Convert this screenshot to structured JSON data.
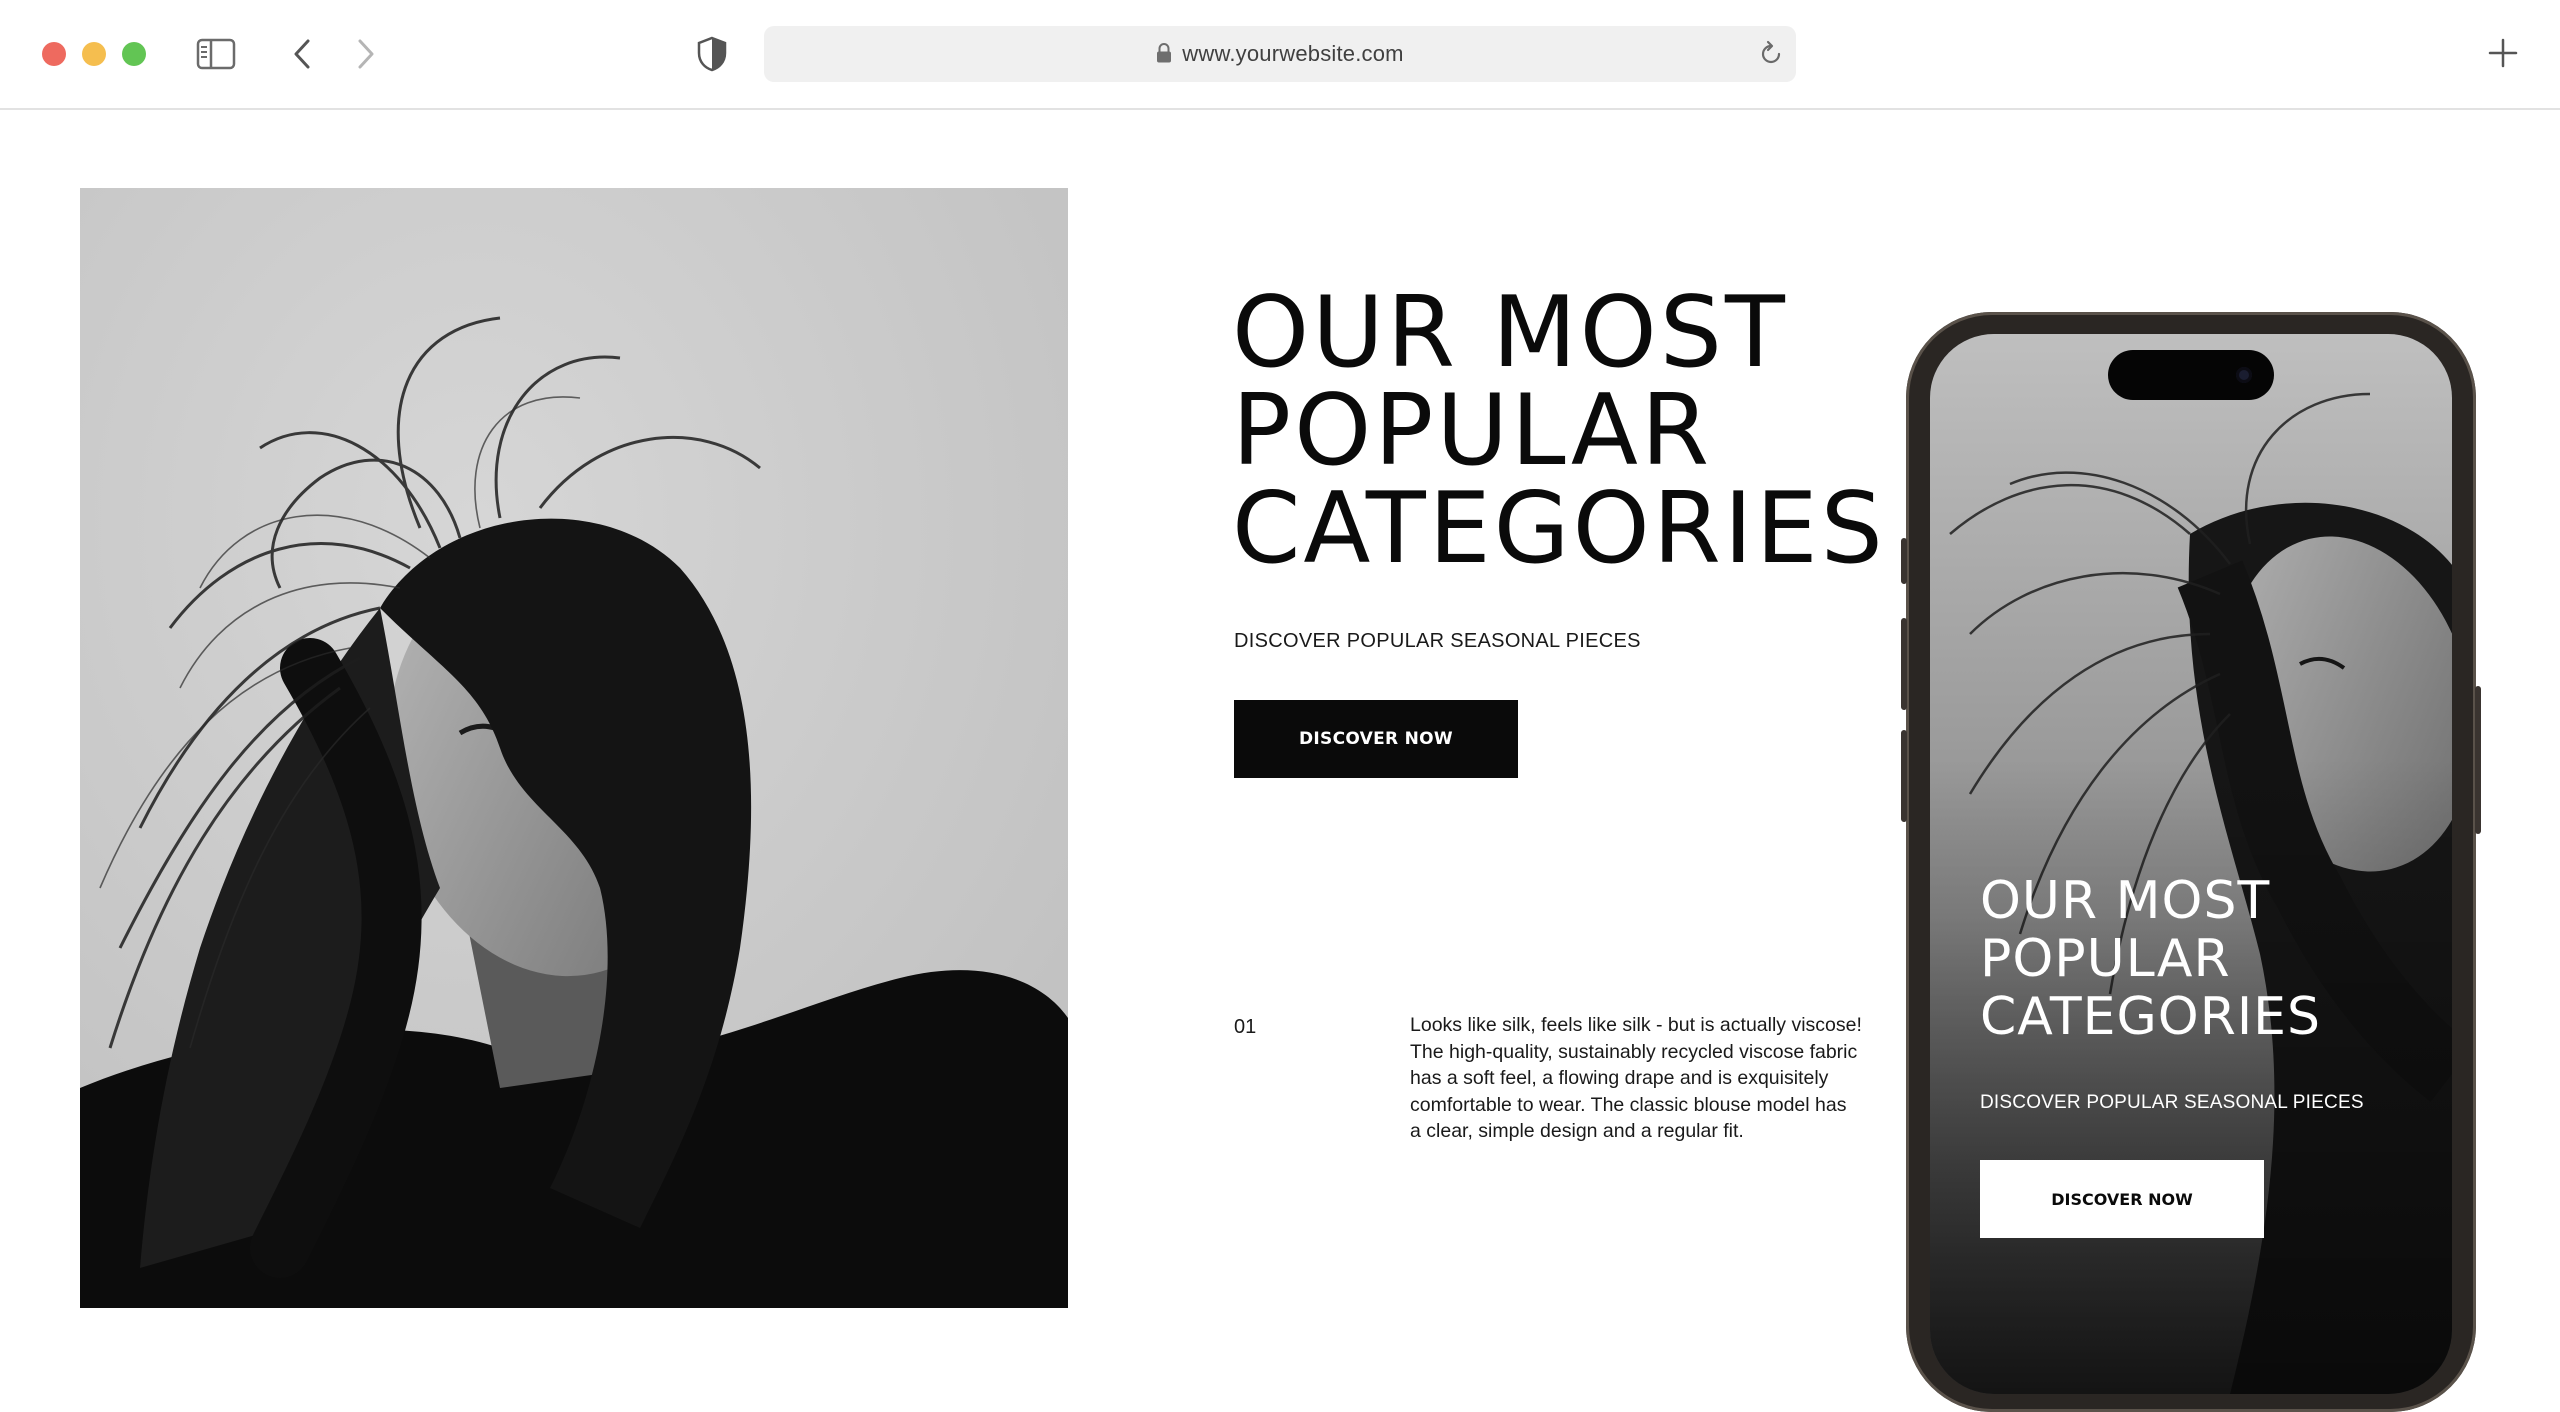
{
  "browser": {
    "url": "www.yourwebsite.com",
    "icons": [
      "close-dot",
      "minimize-dot",
      "zoom-dot",
      "sidebar-icon",
      "back-icon",
      "forward-icon",
      "shield-icon",
      "lock-icon",
      "reload-icon",
      "new-tab-icon"
    ]
  },
  "hero": {
    "headline": [
      "OUR MOST",
      "POPULAR",
      "CATEGORIES"
    ],
    "subheading": "DISCOVER POPULAR SEASONAL PIECES",
    "cta_label": "DISCOVER NOW",
    "photo": "black-and-white portrait of woman with windswept hair"
  },
  "feature": {
    "number": "01",
    "description": "Looks like silk, feels like silk - but is actually viscose! The high-quality, sustainably recycled viscose fabric has a soft feel, a flowing drape and is exquisitely comfortable to wear. The classic blouse model has a clear, simple design and a regular fit."
  },
  "mobile_preview": {
    "headline": [
      "OUR MOST",
      "POPULAR",
      "CATEGORIES"
    ],
    "subheading": "DISCOVER POPULAR SEASONAL PIECES",
    "cta_label": "DISCOVER NOW"
  },
  "colors": {
    "accent": "#0a0a0a",
    "background": "#ffffff"
  }
}
